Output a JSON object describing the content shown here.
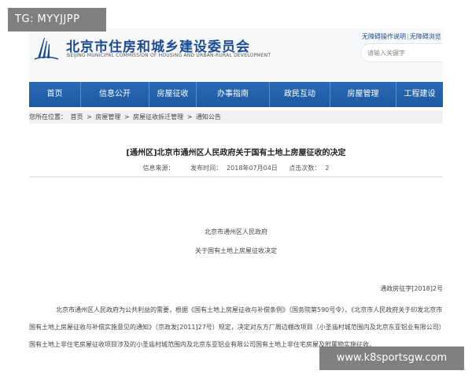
{
  "watermarks": {
    "top_left": "TG: MYYJJPP",
    "bottom_right": "www.k8sportsgw.com"
  },
  "header": {
    "site_title": "北京市住房和城乡建设委员会",
    "site_subtitle": "BEIJING MUNICIPAL COMMISSION OF HOUSING AND URBAN-RURAL DEVELOPMENT",
    "util_links": [
      "无障碍操作说明",
      "无障碍浏览"
    ],
    "search_placeholder": "请输入关键字"
  },
  "nav": {
    "items": [
      "首页",
      "信息公开",
      "房屋征收",
      "办事指南",
      "政民互动",
      "房屋管理",
      "工程建设"
    ]
  },
  "breadcrumb": {
    "prefix": "您所在位置：",
    "items": [
      "首页",
      "房屋管理",
      "房屋征收拆迁管理",
      "通知公告"
    ],
    "separator": ">"
  },
  "article": {
    "title": "[通州区]北京市通州区人民政府关于国有土地上房屋征收的决定",
    "source_label": "信息来源：",
    "source_value": "",
    "date_label": "发布时间：",
    "date_value": "2018年07月04日",
    "views_label": "点击次数：",
    "views_value": "2",
    "issuer": "北京市通州区人民政府",
    "decision_title": "关于国有土地上房屋征收决定",
    "doc_number": "通政房征字[2018]2号",
    "body": "北京市通州区人民政府为公共利益的需要，根据《国有土地上房屋征收与补偿条例》（国务院第590号令）、《北京市人民政府关于印发北京市国有土地上房屋征收与补偿实施意见的通知》（京政发[2011]27号）规定，决定对东方厂周边棚改项目（小圣庙村城范围内及北京东亚铝业有限公司）国有土地上非住宅房屋征收项目涉及的小圣庙村城范围内及北京东亚铝业有限公司国有土地上非住宅房屋及附属物实施征收。"
  },
  "colors": {
    "nav_bg": "#1e5aa2",
    "brand_blue": "#1b4b94"
  }
}
